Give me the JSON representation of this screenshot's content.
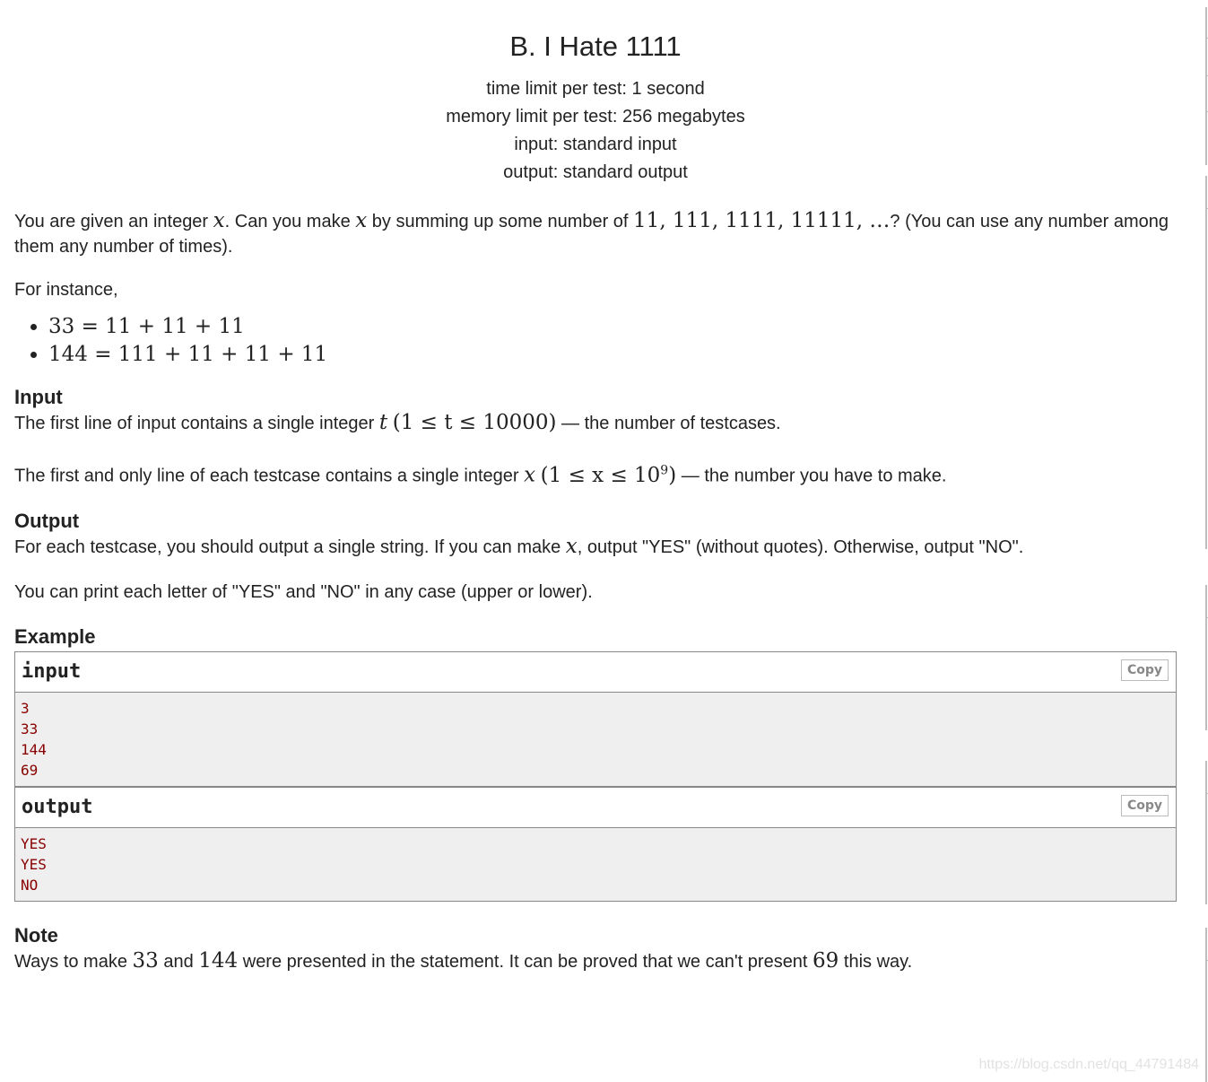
{
  "problem": {
    "title": "B. I Hate 1111",
    "meta": {
      "time_limit": "time limit per test: 1 second",
      "memory_limit": "memory limit per test: 256 megabytes",
      "input": "input: standard input",
      "output": "output: standard output"
    },
    "statement": {
      "p1_a": "You are given an integer ",
      "p1_x1": "x",
      "p1_b": ". Can you make ",
      "p1_x2": "x",
      "p1_c": " by summing up some number of ",
      "p1_series": "11, 111, 1111, 11111, …",
      "p1_d": "? (You can use any number among them any number of times).",
      "p2": "For instance,",
      "examples": [
        "33 = 11 + 11 + 11",
        "144 = 111 + 11 + 11 + 11"
      ]
    },
    "input_section": {
      "title": "Input",
      "p1_a": "The first line of input contains a single integer ",
      "p1_var": "t",
      "p1_math": "(1 ≤ t ≤ 10000)",
      "p1_b": " — the number of testcases.",
      "p2_a": "The first and only line of each testcase contains a single integer ",
      "p2_var": "x",
      "p2_math_pre": "(1 ≤ x ≤ 10",
      "p2_math_sup": "9",
      "p2_math_post": ")",
      "p2_b": " — the number you have to make."
    },
    "output_section": {
      "title": "Output",
      "p1_a": "For each testcase, you should output a single string. If you can make ",
      "p1_var": "x",
      "p1_b": ", output \"YES\" (without quotes). Otherwise, output \"NO\".",
      "p2": "You can print each letter of \"YES\" and \"NO\" in any case (upper or lower)."
    },
    "example_section": {
      "title": "Example",
      "input_label": "input",
      "output_label": "output",
      "copy_label": "Copy",
      "input_lines": [
        "3",
        "33",
        "144",
        "69"
      ],
      "output_lines": [
        "YES",
        "YES",
        "NO"
      ]
    },
    "note_section": {
      "title": "Note",
      "a": "Ways to make ",
      "n1": "33",
      "b": " and ",
      "n2": "144",
      "c": " were presented in the statement. It can be proved that we can't present ",
      "n3": "69",
      "d": " this way."
    }
  },
  "watermark": "https://blog.csdn.net/qq_44791484",
  "colors": {
    "sample_text": "#880000",
    "sample_bg": "#efefef",
    "border": "#888888"
  }
}
